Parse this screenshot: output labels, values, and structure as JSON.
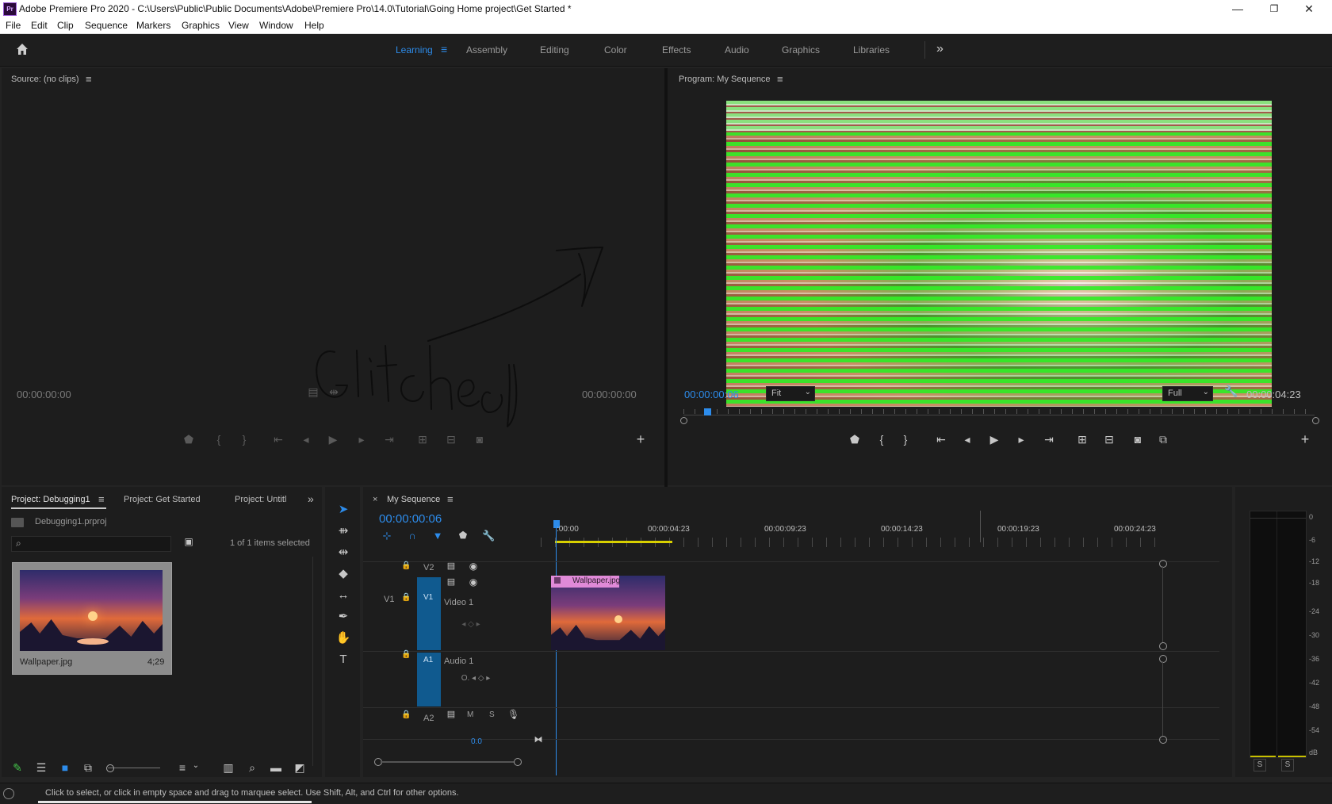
{
  "window": {
    "title": "Adobe Premiere Pro 2020 - C:\\Users\\Public\\Public Documents\\Adobe\\Premiere Pro\\14.0\\Tutorial\\Going Home project\\Get Started *",
    "app_icon": "Pr",
    "controls": {
      "minimize": "—",
      "maximize": "❐",
      "close": "✕"
    }
  },
  "menu": [
    "File",
    "Edit",
    "Clip",
    "Sequence",
    "Markers",
    "Graphics",
    "View",
    "Window",
    "Help"
  ],
  "workspaces": {
    "tabs": [
      "Learning",
      "Assembly",
      "Editing",
      "Color",
      "Effects",
      "Audio",
      "Graphics",
      "Libraries"
    ],
    "active": "Learning",
    "menu_glyph": "≡",
    "overflow": "»"
  },
  "source": {
    "title": "Source: (no clips)",
    "menu_glyph": "≡",
    "timecode_in": "00:00:00:00",
    "timecode_out": "00:00:00:00"
  },
  "program": {
    "title": "Program: My Sequence",
    "menu_glyph": "≡",
    "timecode": "00:00:00:06",
    "fit": "Fit",
    "quality": "Full",
    "duration": "00:00:04:23"
  },
  "project": {
    "tabs": [
      "Project: Debugging1",
      "Project: Get Started",
      "Project: Untitl"
    ],
    "menu_glyph": "≡",
    "overflow": "»",
    "file": "Debugging1.prproj",
    "selection": "1 of 1 items selected",
    "items": [
      {
        "name": "Wallpaper.jpg",
        "duration": "4;29"
      }
    ]
  },
  "timeline": {
    "title": "My Sequence",
    "close": "×",
    "menu_glyph": "≡",
    "timecode": "00:00:00:06",
    "ruler": [
      ":00:00",
      "00:00:04:23",
      "00:00:09:23",
      "00:00:14:23",
      "00:00:19:23",
      "00:00:24:23"
    ],
    "tracks": {
      "v2": "V2",
      "v1_src": "V1",
      "v1": "V1",
      "video1": "Video 1",
      "a1": "A1",
      "audio1": "Audio 1",
      "a2": "A2",
      "mute": "M",
      "solo": "S"
    },
    "clip": "Wallpaper.jpg",
    "volume": "0.0"
  },
  "meter": {
    "scale": [
      "0",
      "-6",
      "-12",
      "-18",
      "-24",
      "-30",
      "-36",
      "-42",
      "-48",
      "-54",
      "dB"
    ],
    "solo_left": "S",
    "solo_right": "S"
  },
  "status": "Click to select, or click in empty space and drag to marquee select. Use Shift, Alt, and Ctrl for other options.",
  "colors": {
    "accent": "#2d8ceb",
    "clip_label": "#e08ad8",
    "track_target": "#105a8f",
    "playhead_bar": "#d8d000",
    "glitch_green": "#2cf024"
  }
}
